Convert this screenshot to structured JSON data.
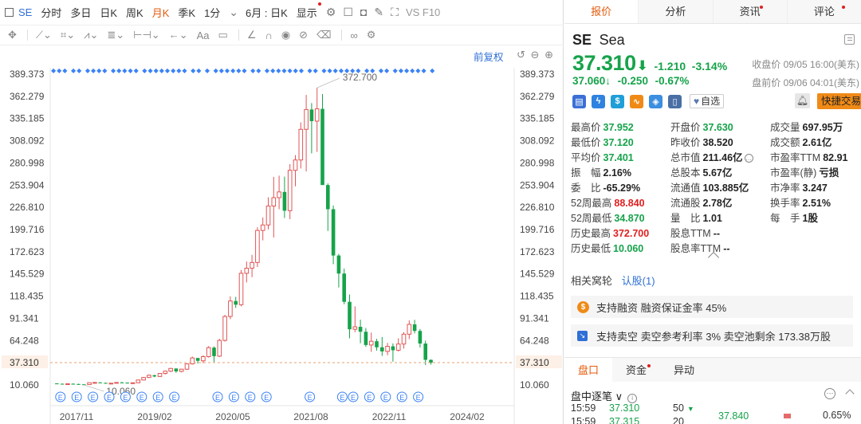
{
  "toolbar": {
    "symbol": "SE",
    "periods": [
      "分时",
      "多日",
      "日K",
      "周K",
      "月K",
      "季K",
      "1分"
    ],
    "active_period": "月K",
    "range": "6月 : 日K",
    "display": "显示",
    "right_text": "VS F10"
  },
  "chart": {
    "restore_label": "前复权",
    "price_label": "372.700",
    "low_label": "10.060",
    "current_tag": "37.310"
  },
  "chart_data": {
    "type": "candlestick",
    "y_ticks": [
      "389.373",
      "362.279",
      "335.185",
      "308.092",
      "280.998",
      "253.904",
      "226.810",
      "199.716",
      "172.623",
      "145.529",
      "118.435",
      "91.341",
      "64.248",
      "37.310",
      "10.060"
    ],
    "ylim": [
      10.06,
      389.373
    ],
    "x_ticks": [
      "2017/11",
      "2019/02",
      "2020/05",
      "2021/08",
      "2022/11",
      "2024/02"
    ],
    "current": 37.31,
    "high": 372.7,
    "low": 10.06,
    "candles": [
      [
        11.9,
        12.2,
        11,
        11.5
      ],
      [
        11.5,
        11.8,
        10.5,
        11.3
      ],
      [
        11.3,
        11.8,
        10.9,
        11.5
      ],
      [
        11.5,
        12,
        10.8,
        11.2
      ],
      [
        11.2,
        11.6,
        10.3,
        10.8
      ],
      [
        10.8,
        11.2,
        10.1,
        10.6
      ],
      [
        10.6,
        13,
        10.6,
        12.8
      ],
      [
        12.8,
        13.6,
        12.2,
        13.1
      ],
      [
        13.1,
        13.5,
        12.2,
        12.6
      ],
      [
        12.6,
        13,
        11.6,
        11.8
      ],
      [
        11.8,
        12.5,
        11.3,
        12.2
      ],
      [
        12.2,
        13.4,
        11.8,
        13.1
      ],
      [
        13.1,
        13.8,
        12.4,
        12.9
      ],
      [
        12.9,
        13.1,
        11.8,
        12
      ],
      [
        12,
        13,
        11.6,
        12.7
      ],
      [
        12.7,
        16.5,
        12.5,
        16.1
      ],
      [
        16.1,
        19.8,
        15.6,
        19.2
      ],
      [
        19.2,
        22.8,
        18.6,
        21.9
      ],
      [
        21.9,
        22.6,
        19.5,
        20.4
      ],
      [
        20.4,
        24.6,
        20,
        24.1
      ],
      [
        24.1,
        27.6,
        22.8,
        26.9
      ],
      [
        26.9,
        31,
        25.7,
        30.2
      ],
      [
        30.2,
        29.5,
        24.9,
        26.6
      ],
      [
        26.6,
        29.8,
        25.4,
        29.3
      ],
      [
        29.3,
        36.5,
        28.3,
        35.8
      ],
      [
        35.8,
        44.7,
        34.9,
        43
      ],
      [
        43,
        42.8,
        36.2,
        39.5
      ],
      [
        39.5,
        46.3,
        36.6,
        44.6
      ],
      [
        44.6,
        57.5,
        43.4,
        55.6
      ],
      [
        55.6,
        57,
        38.2,
        45.2
      ],
      [
        45.2,
        66.4,
        44.1,
        64.4
      ],
      [
        64.4,
        95.6,
        63,
        93.6
      ],
      [
        93.6,
        118.1,
        90.4,
        112.5
      ],
      [
        112.5,
        117.6,
        104,
        108
      ],
      [
        108,
        150.4,
        106.1,
        146.3
      ],
      [
        146.3,
        160.6,
        135.2,
        152.5
      ],
      [
        152.5,
        168.8,
        141.6,
        159.5
      ],
      [
        159.5,
        202.5,
        154,
        198.6
      ],
      [
        198.6,
        214.5,
        186.5,
        205.3
      ],
      [
        205.3,
        239,
        199.8,
        228.4
      ],
      [
        228.4,
        264,
        190,
        238.6
      ],
      [
        238.6,
        265.5,
        224.5,
        245.6
      ],
      [
        245.6,
        264.3,
        213.8,
        222.7
      ],
      [
        222.7,
        279.5,
        212.3,
        272
      ],
      [
        272,
        290.5,
        252.5,
        284.6
      ],
      [
        284.6,
        330.5,
        274.2,
        322
      ],
      [
        322,
        364,
        270.6,
        346.2
      ],
      [
        346.2,
        354,
        292.7,
        332
      ],
      [
        332,
        372.7,
        294.5,
        347
      ],
      [
        347,
        365,
        257,
        254
      ],
      [
        254,
        256,
        198,
        224.5
      ],
      [
        224.5,
        229,
        157.4,
        168
      ],
      [
        168,
        170,
        129,
        146
      ],
      [
        146,
        152,
        108.5,
        111.5
      ],
      [
        111.5,
        120.5,
        67,
        78
      ],
      [
        78,
        106,
        74.5,
        81
      ],
      [
        81,
        89.7,
        61,
        75
      ],
      [
        75,
        79.5,
        56.5,
        58.8
      ],
      [
        58.8,
        74,
        50.5,
        63.4
      ],
      [
        63.4,
        66.4,
        52,
        56
      ],
      [
        56,
        68.6,
        45.5,
        51
      ],
      [
        51,
        61.4,
        46.3,
        57.2
      ],
      [
        57.2,
        60.8,
        38.5,
        52.4
      ],
      [
        52.4,
        67,
        50.8,
        60
      ],
      [
        60,
        74.5,
        54.4,
        72
      ],
      [
        72,
        88.8,
        66,
        84
      ],
      [
        84,
        89.5,
        73,
        76
      ],
      [
        76,
        78.4,
        55.7,
        60.6
      ],
      [
        60.6,
        64.2,
        34.4,
        40.7
      ],
      [
        40.7,
        41.2,
        34.9,
        37.3
      ]
    ],
    "event_dots": "◆◆◆ ◆◆ ◆◆◆◆ ◆◆◆◆◆ ◆◆◆◆◆◆◆◆ ◆◆ ◆ ◆◆◆◆◆◆ ◆◆ ◆◆◆◆◆◆◆ ◆◆ ◆◆◆◆◆◆◆ ◆◆ ◆◆ ◆◆◆◆◆◆ ◆"
  },
  "quote": {
    "tabs": [
      {
        "label": "报价",
        "dot": false
      },
      {
        "label": "分析",
        "dot": false
      },
      {
        "label": "资讯",
        "dot": true
      },
      {
        "label": "评论",
        "dot": true
      }
    ],
    "code": "SE",
    "name": "Sea",
    "price": "37.310",
    "change": "-1.210",
    "change_pct": "-3.14%",
    "close_time": "收盘价 09/05 16:00(美东)",
    "pre_price": "37.060↓",
    "pre_change": "-0.250",
    "pre_pct": "-0.67%",
    "pre_time": "盘前价 09/06 04:01(美东)",
    "watch_label": "自选",
    "trade_label": "快捷交易",
    "badge_colors": [
      "#3b6fd6",
      "#2f82e0",
      "#1f9fd8",
      "#f08a16",
      "#3b8ee0",
      "#4a6fa5"
    ]
  },
  "stats": [
    [
      {
        "k": "最高价",
        "v": "37.952",
        "c": "green"
      },
      {
        "k": "开盘价",
        "v": "37.630",
        "c": "green"
      },
      {
        "k": "成交量",
        "v": "697.95万",
        "c": ""
      }
    ],
    [
      {
        "k": "最低价",
        "v": "37.120",
        "c": "green"
      },
      {
        "k": "昨收价",
        "v": "38.520",
        "c": ""
      },
      {
        "k": "成交额",
        "v": "2.61亿",
        "c": ""
      }
    ],
    [
      {
        "k": "平均价",
        "v": "37.401",
        "c": "green"
      },
      {
        "k": "总市值",
        "v": "211.46亿",
        "c": ""
      },
      {
        "k": "市盈率TTM",
        "v": "82.91",
        "c": ""
      }
    ],
    [
      {
        "k": "振　幅",
        "v": "2.16%",
        "c": ""
      },
      {
        "k": "总股本",
        "v": "5.67亿",
        "c": ""
      },
      {
        "k": "市盈率(静)",
        "v": "亏损",
        "c": ""
      }
    ],
    [
      {
        "k": "委　比",
        "v": "-65.29%",
        "c": ""
      },
      {
        "k": "流通值",
        "v": "103.885亿",
        "c": ""
      },
      {
        "k": "市净率",
        "v": "3.247",
        "c": ""
      }
    ],
    [
      {
        "k": "52周最高",
        "v": "88.840",
        "c": "red"
      },
      {
        "k": "流通股",
        "v": "2.78亿",
        "c": ""
      },
      {
        "k": "换手率",
        "v": "2.51%",
        "c": ""
      }
    ],
    [
      {
        "k": "52周最低",
        "v": "34.870",
        "c": "green"
      },
      {
        "k": "量　比",
        "v": "1.01",
        "c": ""
      },
      {
        "k": "每　手",
        "v": "1股",
        "c": ""
      }
    ],
    [
      {
        "k": "历史最高",
        "v": "372.700",
        "c": "red"
      },
      {
        "k": "股息TTM",
        "v": "--",
        "c": ""
      },
      {
        "k": "",
        "v": "",
        "c": ""
      }
    ],
    [
      {
        "k": "历史最低",
        "v": "10.060",
        "c": "green"
      },
      {
        "k": "股息率TTM",
        "v": "--",
        "c": ""
      },
      {
        "k": "",
        "v": "",
        "c": ""
      }
    ]
  ],
  "related": {
    "label": "相关窝轮",
    "link": "认股(1)"
  },
  "margin": {
    "text": "支持融资  融资保证金率 45%"
  },
  "short": {
    "text": "支持卖空  卖空参考利率 3%  卖空池剩余 173.38万股"
  },
  "tabs2": [
    {
      "label": "盘口",
      "dot": false
    },
    {
      "label": "资金",
      "dot": true
    },
    {
      "label": "异动",
      "dot": false
    }
  ],
  "ticks": {
    "title": "盘中逐笔 ∨",
    "rows": [
      {
        "time": "15:59",
        "price": "37.310",
        "vol": "50"
      },
      {
        "time": "15:59",
        "price": "37.315",
        "vol": "20"
      }
    ],
    "side_price": "37.840",
    "side_pct": "0.65%"
  }
}
